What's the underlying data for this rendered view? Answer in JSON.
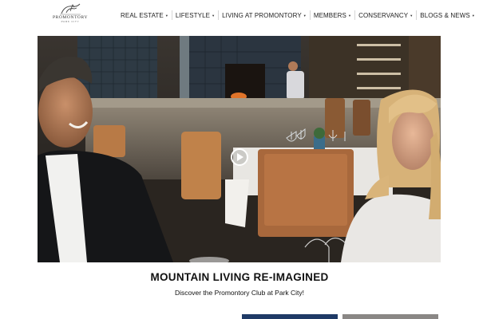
{
  "header": {
    "logo_text": "PROMONTORY",
    "logo_subtext": "PARK CITY"
  },
  "nav": {
    "items": [
      {
        "label": "REAL ESTATE"
      },
      {
        "label": "LIFESTYLE"
      },
      {
        "label": "LIVING AT PROMONTORY"
      },
      {
        "label": "MEMBERS"
      },
      {
        "label": "CONSERVANCY"
      },
      {
        "label": "BLOGS & NEWS"
      }
    ],
    "caret_icon": "caret-down-icon"
  },
  "hero": {
    "play_icon": "play-icon"
  },
  "content": {
    "headline": "MOUNTAIN LIVING RE-IMAGINED",
    "subline": "Discover the Promontory Club at Park City!"
  },
  "colors": {
    "accent_blue": "#1f3a66",
    "nav_text": "#222222"
  }
}
